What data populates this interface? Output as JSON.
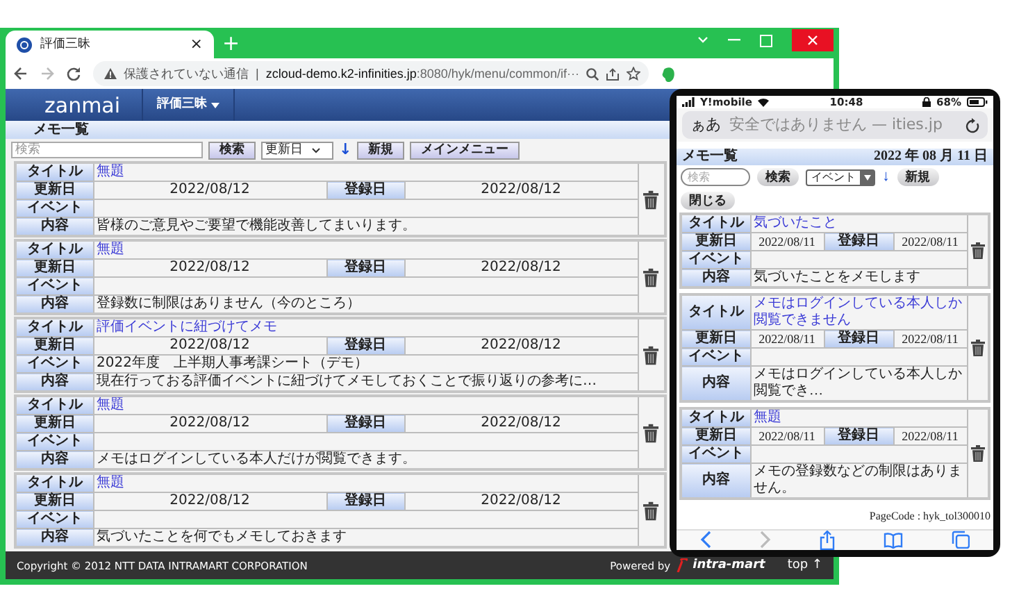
{
  "browser": {
    "tab": {
      "title": "評価三昧",
      "close": "×"
    },
    "new_tab": "+",
    "nav_buttons": [
      {
        "kind": "back",
        "disabled": false
      },
      {
        "kind": "forward",
        "disabled": true
      },
      {
        "kind": "reload",
        "disabled": false
      }
    ],
    "address": {
      "warning": "保護されていない通信",
      "separator": "|",
      "host": "zcloud-demo.k2-infinities.jp",
      "path": ":8080/hyk/menu/common/if···"
    }
  },
  "navbar": {
    "brand": "zanmai",
    "menu": "評価三昧"
  },
  "page": {
    "heading": "メモ一覧",
    "search": {
      "placeholder": "検索"
    },
    "search_button": "検索",
    "sort": "更新日",
    "sort_arrow": "↓",
    "buttons": [
      "新規",
      "メインメニュー"
    ]
  },
  "memos": [
    {
      "title_label": "タイトル",
      "title": "無題",
      "updated_label": "更新日",
      "updated": "2022/08/12",
      "registered_label": "登録日",
      "registered": "2022/08/12",
      "event_label": "イベント",
      "content_label": "内容",
      "content": "皆様のご意見やご要望で機能改善してまいります。"
    },
    {
      "title_label": "タイトル",
      "title": "無題",
      "updated_label": "更新日",
      "updated": "2022/08/12",
      "registered_label": "登録日",
      "registered": "2022/08/12",
      "event_label": "イベント",
      "content_label": "内容",
      "content": "登録数に制限はありません（今のところ）"
    },
    {
      "title_label": "タイトル",
      "title": "評価イベントに紐づけてメモ",
      "updated_label": "更新日",
      "updated": "2022/08/12",
      "registered_label": "登録日",
      "registered": "2022/08/12",
      "event_label": "イベント",
      "event": "2022年度　上半期人事考課シート（デモ）",
      "content_label": "内容",
      "content": "現在行っておる評価イベントに紐づけてメモしておくことで振り返りの参考に…"
    },
    {
      "title_label": "タイトル",
      "title": "無題",
      "updated_label": "更新日",
      "updated": "2022/08/12",
      "registered_label": "登録日",
      "registered": "2022/08/12",
      "event_label": "イベント",
      "content_label": "内容",
      "content": "メモはログインしている本人だけが閲覧できます。"
    },
    {
      "title_label": "タイトル",
      "title": "無題",
      "updated_label": "更新日",
      "updated": "2022/08/12",
      "registered_label": "登録日",
      "registered": "2022/08/12",
      "event_label": "イベント",
      "content_label": "内容",
      "content": "気づいたことを何でもメモしておきます"
    }
  ],
  "footer": {
    "copyright": "Copyright © 2012 NTT DATA INTRAMART CORPORATION",
    "powered_by": "Powered by",
    "logo": "intra-mart",
    "top": "top ↑"
  },
  "phone": {
    "carrier": "Y!mobile",
    "time": "10:48",
    "battery": "68%",
    "text_size": "ぁあ",
    "url": "安全ではありません — ities.jp",
    "heading": "メモ一覧",
    "date": "2022 年 08 月 11 日",
    "search": {
      "placeholder": "検索"
    },
    "search_button": "検索",
    "filter": "イベント",
    "sort_arrow": "↓",
    "new_button": "新規",
    "close_button": "閉じる",
    "memos": [
      {
        "title_label": "タイトル",
        "title": "気づいたこと",
        "updated_label": "更新日",
        "updated": "2022/08/11",
        "registered_label": "登録日",
        "registered": "2022/08/11",
        "event_label": "イベント",
        "content_label": "内容",
        "content": "気づいたことをメモします"
      },
      {
        "title_label": "タイトル",
        "title": "メモはログインしている本人しか閲覧できません",
        "updated_label": "更新日",
        "updated": "2022/08/11",
        "registered_label": "登録日",
        "registered": "2022/08/11",
        "event_label": "イベント",
        "content_label": "内容",
        "content": "メモはログインしている本人しか閲覧でき…"
      },
      {
        "title_label": "タイトル",
        "title": "無題",
        "updated_label": "更新日",
        "updated": "2022/08/11",
        "registered_label": "登録日",
        "registered": "2022/08/11",
        "event_label": "イベント",
        "content_label": "内容",
        "content": "メモの登録数などの制限はありません。"
      }
    ],
    "page_code": "PageCode : hyk_tol300010",
    "toolbar": [
      {
        "kind": "back",
        "disabled": false
      },
      {
        "kind": "forward",
        "disabled": true
      },
      {
        "kind": "share",
        "disabled": false
      },
      {
        "kind": "bookmarks",
        "disabled": false
      },
      {
        "kind": "tabs",
        "disabled": false
      }
    ]
  }
}
